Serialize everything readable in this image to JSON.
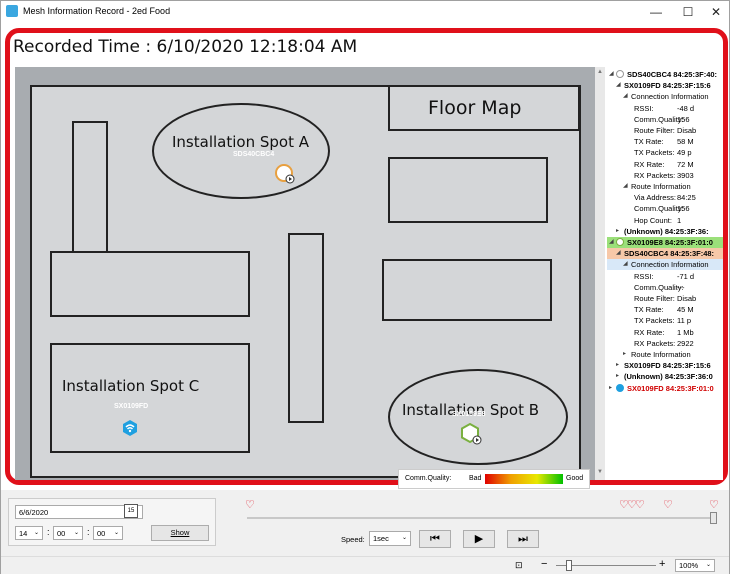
{
  "window": {
    "title": "Mesh Information Record - 2ed Food",
    "minimize": "—",
    "maximize": "☐",
    "close": "✕"
  },
  "recorded_time": "Recorded Time : 6/10/2020 12:18:04 AM",
  "map": {
    "floor_title": "Floor Map",
    "spots": {
      "a": "Installation Spot A",
      "b": "Installation Spot B",
      "c": "Installation Spot C"
    },
    "devices": {
      "a": "SDS40CBC4",
      "b": "SX0109E8",
      "c": "SX0109FD"
    },
    "legend": {
      "label": "Comm.Quality:",
      "bad": "Bad",
      "good": "Good"
    },
    "colors": {
      "bad": "#e00000",
      "good": "#00c000",
      "frame": "#e0101a"
    }
  },
  "tree": {
    "rows": [
      {
        "indent": 0,
        "exp": "◢",
        "text": "SDS40CBC4  84:25:3F:40:",
        "bold": true
      },
      {
        "indent": 1,
        "exp": "◢",
        "text": "SX0109FD  84:25:3F:15:6",
        "bold": true
      },
      {
        "indent": 2,
        "exp": "◢",
        "text": "Connection Information"
      },
      {
        "indent": 3,
        "key": "RSSI:",
        "val": "-48 d"
      },
      {
        "indent": 3,
        "key": "Comm.Quality:",
        "val": "156"
      },
      {
        "indent": 3,
        "key": "Route Filter:",
        "val": "Disab"
      },
      {
        "indent": 3,
        "key": "TX Rate:",
        "val": "58 M"
      },
      {
        "indent": 3,
        "key": "TX Packets:",
        "val": "49 p"
      },
      {
        "indent": 3,
        "key": "RX Rate:",
        "val": "72 M"
      },
      {
        "indent": 3,
        "key": "RX Packets:",
        "val": "3903"
      },
      {
        "indent": 2,
        "exp": "◢",
        "text": "Route Information"
      },
      {
        "indent": 3,
        "key": "Via Address:",
        "val": "84:25"
      },
      {
        "indent": 3,
        "key": "Comm.Quality:",
        "val": "156"
      },
      {
        "indent": 3,
        "key": "Hop Count:",
        "val": "1"
      },
      {
        "indent": 1,
        "exp": "▸",
        "text": "(Unknown)  84:25:3F:36:",
        "bold": true
      },
      {
        "indent": 0,
        "exp": "◢",
        "text": "SX0109E8  84:25:3F:01:0",
        "bold": true,
        "bg": "#9be07a"
      },
      {
        "indent": 1,
        "exp": "◢",
        "text": "SDS40CBC4  84:25:3F:48:",
        "bold": true,
        "bg": "#f7c8a8"
      },
      {
        "indent": 2,
        "exp": "◢",
        "text": "Connection Information",
        "bg": "#d8e8f8"
      },
      {
        "indent": 3,
        "key": "RSSI:",
        "val": "-71 d"
      },
      {
        "indent": 3,
        "key": "Comm.Quality:",
        "val": "---"
      },
      {
        "indent": 3,
        "key": "Route Filter:",
        "val": "Disab"
      },
      {
        "indent": 3,
        "key": "TX Rate:",
        "val": "45 M"
      },
      {
        "indent": 3,
        "key": "TX Packets:",
        "val": "11 p"
      },
      {
        "indent": 3,
        "key": "RX Rate:",
        "val": "1 Mb"
      },
      {
        "indent": 3,
        "key": "RX Packets:",
        "val": "2922"
      },
      {
        "indent": 2,
        "exp": "▸",
        "text": "Route Information"
      },
      {
        "indent": 1,
        "exp": "▸",
        "text": "SX0109FD  84:25:3F:15:6",
        "bold": true
      },
      {
        "indent": 1,
        "exp": "▸",
        "text": "(Unknown)  84:25:3F:36:0",
        "bold": true
      },
      {
        "indent": 0,
        "exp": "▸",
        "text": "SX0109FD  84:25:3F:01:0",
        "bold": true,
        "red": true
      }
    ]
  },
  "controls": {
    "date": "6/6/2020",
    "calendar_day": "15",
    "hour": "14",
    "minute": "00",
    "second": "00",
    "colon": ":",
    "show": "Show",
    "speed_label": "Speed:",
    "speed_value": "1sec",
    "zoom_value": "100%"
  }
}
